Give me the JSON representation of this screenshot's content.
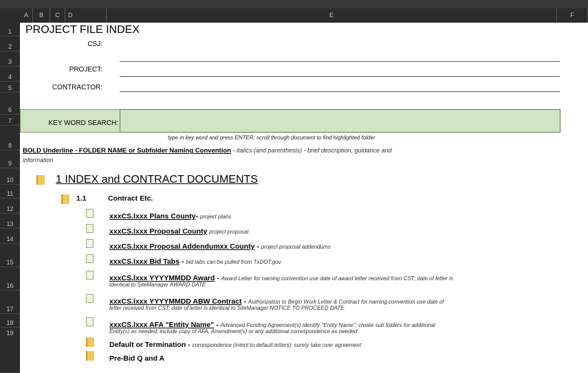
{
  "columns": [
    "A",
    "B",
    "C",
    "D",
    "E",
    "F"
  ],
  "rows": [
    "1",
    "2",
    "3",
    "4",
    "5",
    "6",
    "7",
    "8",
    "9",
    "10",
    "11",
    "12",
    "13",
    "14",
    "15",
    "16",
    "17",
    "18",
    "19"
  ],
  "title": "PROJECT FILE INDEX",
  "fields": {
    "csj_label": "CSJ:",
    "project_label": "PROJECT:",
    "contractor_label": "CONTRACTOR:",
    "keyword_label": "KEY WORD SEARCH:"
  },
  "search_hint": "type in key word and press ENTER; scroll through document to find highlighted folder",
  "legend": {
    "bold_part": "BOLD Underline - FOLDER NAME or Subfolder Naming Convention",
    "italic_part": " - italics (and parenthesis) - brief description, guidance and",
    "continued": "information"
  },
  "section1": {
    "title": "1 INDEX and CONTRACT DOCUMENTS",
    "sub_number": "1.1",
    "sub_title": "Contract Etc."
  },
  "items": [
    {
      "name": "xxxCS.lxxx Plans County",
      "desc": "project plans",
      "sep": "- "
    },
    {
      "name": "xxxCS.lxxx Proposal County",
      "desc": "project proposal",
      "sep": "  "
    },
    {
      "name": "xxxCS.lxxx Proposal Addendumxx County",
      "desc": "project proposal addendums",
      "sep": " - "
    },
    {
      "name": "xxxCS.lxxx Bid Tabs",
      "desc": "bid tabs can be pulled from TxDOT.gov",
      "sep": " - "
    },
    {
      "name": "xxxCS.lxxx YYYYMMDD Award",
      "desc": "Award Letter for naming convention use date of award letter received from CST; date of letter is",
      "desc2": "identical to SiteManager AWARD DATE",
      "sep": " - "
    },
    {
      "name": "xxxCS.lxxx YYYYMMDD ABW Contract",
      "desc": "Authorization to Begin Work Letter & Contract for naming convention use date of",
      "desc2": "letter received from CST; date of letter is identical to SiteManager NOTICE TO PROCEED DATE",
      "sep": " - "
    },
    {
      "name": "xxxCS.lxxx AFA \"Entity Name\"",
      "desc": "Advanced Funding Agreement(s) identify \"Entity Name\"; create sub folders for additional",
      "desc2": "Entity(s) as needed; include copy of AFA, Amendment(s) or any additional correspondence as needed",
      "sep": " - "
    }
  ],
  "folders": [
    {
      "name": "Default or Termination",
      "desc": "correspondence (intent to default letters); surety take over agreement"
    },
    {
      "name": "Pre-Bid Q and A",
      "desc": ""
    }
  ],
  "colors": {
    "header_bg": "#2b2b2b",
    "search_fill": "#cfe5c4",
    "folder": "#f0c860"
  }
}
